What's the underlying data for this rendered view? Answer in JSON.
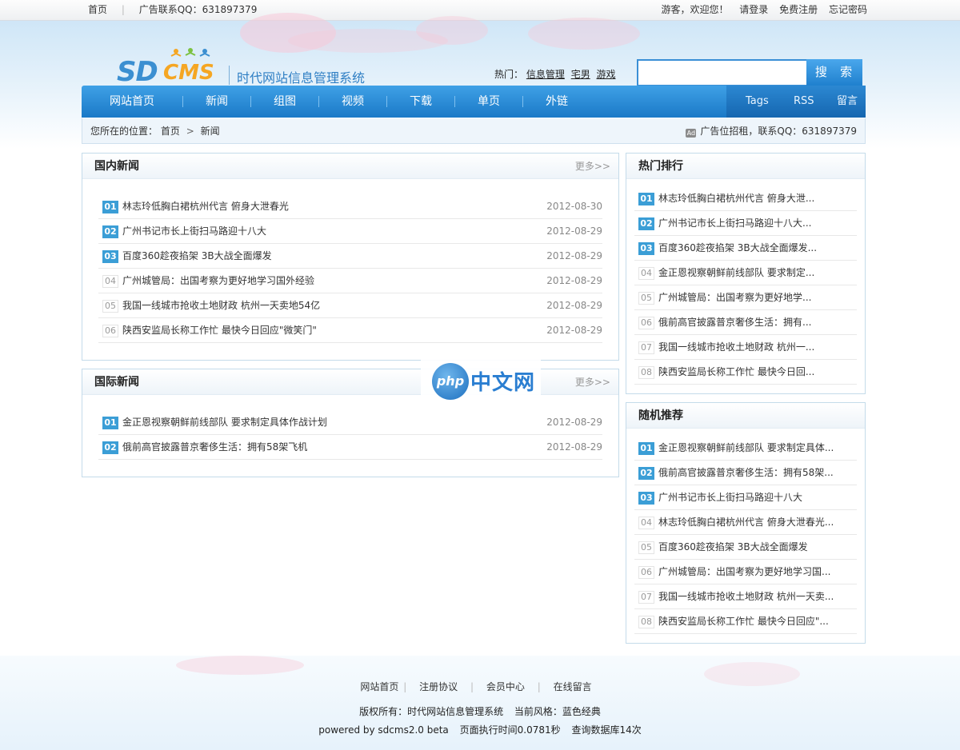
{
  "topbar": {
    "home": "首页",
    "ad_contact": "广告联系QQ：631897379",
    "greeting": "游客，欢迎您！",
    "login": "请登录",
    "register": "免费注册",
    "forgot": "忘记密码"
  },
  "header": {
    "logo_sd": "SD",
    "logo_cms": "CMS",
    "tagline": "时代网站信息管理系统",
    "hot_label": "热门：",
    "hot_links": [
      "信息管理",
      "宅男",
      "游戏"
    ],
    "search_placeholder": "",
    "search_button": "搜 索"
  },
  "nav": {
    "items": [
      "网站首页",
      "新闻",
      "组图",
      "视频",
      "下载",
      "单页",
      "外链"
    ],
    "right": [
      "Tags",
      "RSS",
      "留言"
    ]
  },
  "breadcrumb": {
    "label": "您所在的位置：",
    "home": "首页",
    "arrow": ">",
    "current": "新闻",
    "ad_icon": "Ad",
    "ad_text": "广告位招租，联系QQ：631897379"
  },
  "domestic": {
    "title": "国内新闻",
    "more": "更多>>",
    "items": [
      {
        "num": "01",
        "title": "林志玲低胸白裙杭州代言 俯身大泄春光",
        "date": "2012-08-30"
      },
      {
        "num": "02",
        "title": "广州书记市长上街扫马路迎十八大",
        "date": "2012-08-29"
      },
      {
        "num": "03",
        "title": "百度360趁夜掐架 3B大战全面爆发",
        "date": "2012-08-29"
      },
      {
        "num": "04",
        "title": "广州城管局：出国考察为更好地学习国外经验",
        "date": "2012-08-29"
      },
      {
        "num": "05",
        "title": "我国一线城市抢收土地财政 杭州一天卖地54亿",
        "date": "2012-08-29"
      },
      {
        "num": "06",
        "title": "陕西安监局长称工作忙 最快今日回应\"微笑门\"",
        "date": "2012-08-29"
      }
    ]
  },
  "international": {
    "title": "国际新闻",
    "more": "更多>>",
    "items": [
      {
        "num": "01",
        "title": "金正恩视察朝鲜前线部队 要求制定具体作战计划",
        "date": "2012-08-29"
      },
      {
        "num": "02",
        "title": "俄前高官披露普京奢侈生活：拥有58架飞机",
        "date": "2012-08-29"
      }
    ]
  },
  "hot_rank": {
    "title": "热门排行",
    "items": [
      {
        "num": "01",
        "title": "林志玲低胸白裙杭州代言 俯身大泄..."
      },
      {
        "num": "02",
        "title": "广州书记市长上街扫马路迎十八大..."
      },
      {
        "num": "03",
        "title": "百度360趁夜掐架 3B大战全面爆发..."
      },
      {
        "num": "04",
        "title": "金正恩视察朝鲜前线部队 要求制定..."
      },
      {
        "num": "05",
        "title": "广州城管局：出国考察为更好地学..."
      },
      {
        "num": "06",
        "title": "俄前高官披露普京奢侈生活：拥有..."
      },
      {
        "num": "07",
        "title": "我国一线城市抢收土地财政 杭州一..."
      },
      {
        "num": "08",
        "title": "陕西安监局长称工作忙 最快今日回..."
      }
    ]
  },
  "random": {
    "title": "随机推荐",
    "items": [
      {
        "num": "01",
        "title": "金正恩视察朝鲜前线部队 要求制定具体..."
      },
      {
        "num": "02",
        "title": "俄前高官披露普京奢侈生活：拥有58架..."
      },
      {
        "num": "03",
        "title": "广州书记市长上街扫马路迎十八大"
      },
      {
        "num": "04",
        "title": "林志玲低胸白裙杭州代言 俯身大泄春光..."
      },
      {
        "num": "05",
        "title": "百度360趁夜掐架 3B大战全面爆发"
      },
      {
        "num": "06",
        "title": "广州城管局：出国考察为更好地学习国..."
      },
      {
        "num": "07",
        "title": "我国一线城市抢收土地财政 杭州一天卖..."
      },
      {
        "num": "08",
        "title": "陕西安监局长称工作忙 最快今日回应\"..."
      }
    ]
  },
  "watermark": {
    "php": "php",
    "cn": "中文网"
  },
  "footer": {
    "links": [
      "网站首页",
      "注册协议",
      "会员中心",
      "在线留言"
    ],
    "copyright": "版权所有：时代网站信息管理系统",
    "style": "当前风格：蓝色经典",
    "powered": "powered by sdcms2.0 beta",
    "exec_time": "页面执行时间0.0781秒",
    "queries": "查询数据库14次"
  },
  "colors": {
    "accent": "#1a79c7",
    "badge": "#3b9ed6"
  }
}
